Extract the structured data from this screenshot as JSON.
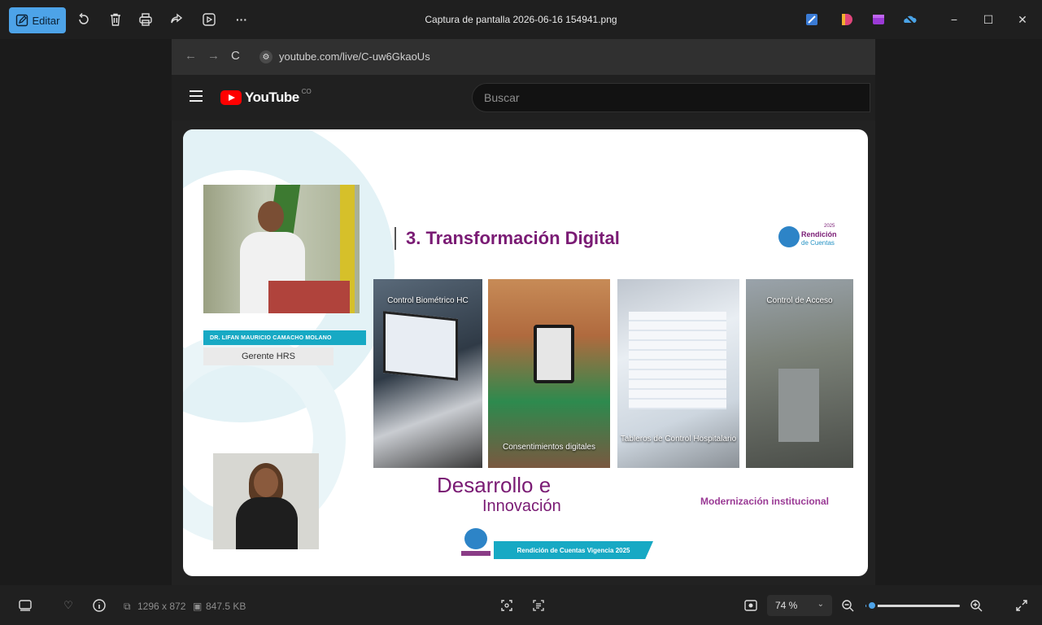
{
  "toolbar": {
    "edit_label": "Editar",
    "icons": [
      "rotate-icon",
      "delete-icon",
      "print-icon",
      "share-icon",
      "slideshow-icon",
      "more-icon"
    ],
    "more_label": "···"
  },
  "window": {
    "file_title": "Captura de pantalla 2026-06-16 154941.png",
    "minimize": "−",
    "maximize": "☐",
    "close": "✕"
  },
  "browser": {
    "url": "youtube.com/live/C-uw6GkaoUs",
    "back": "←",
    "forward": "→",
    "reload": "C"
  },
  "youtube": {
    "wordmark": "YouTube",
    "region": "CO",
    "search_placeholder": "Buscar"
  },
  "slide": {
    "section_title": "3. Transformación Digital",
    "speaker_name": "DR. LIFAN MAURICIO CAMACHO MOLANO",
    "speaker_role": "Gerente HRS",
    "rc_logo": {
      "year": "2025",
      "line1": "Rendición",
      "line2": "de Cuentas"
    },
    "photos": [
      {
        "caption": "Control Biométrico HC"
      },
      {
        "caption": "Consentimientos digitales"
      },
      {
        "caption": "Tableros de Control Hospitalario"
      },
      {
        "caption": "Control de Acceso"
      }
    ],
    "desarrollo": "Desarrollo e",
    "innovacion": "Innovación",
    "modernizacion": "Modernización institucional",
    "footer_banner": "Rendición de Cuentas Vigencia 2025"
  },
  "statusbar": {
    "dimensions": "1296 x 872",
    "filesize": "847.5 KB",
    "zoom_label": "74 %",
    "zoom_level": 0.74
  },
  "colors": {
    "accent": "#4da3e8",
    "slide_purple": "#7a1b74",
    "slide_cyan": "#17a9c4",
    "youtube_red": "#ff0000"
  }
}
